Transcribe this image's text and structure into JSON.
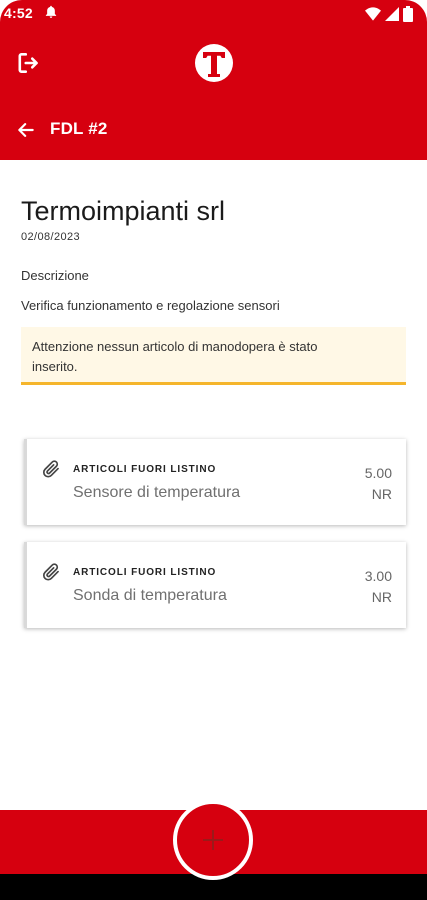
{
  "status_bar": {
    "time": "4:52"
  },
  "toolbar": {
    "title": "FDL #2"
  },
  "work_order": {
    "client_name": "Termoimpianti srl",
    "date": "02/08/2023",
    "description_label": "Descrizione",
    "description": "Verifica funzionamento e regolazione sensori",
    "warning_line1": "Attenzione nessun articolo di manodopera è stato",
    "warning_line2": "inserito."
  },
  "items": [
    {
      "category": "ARTICOLI FUORI LISTINO",
      "name": "Sensore di temperatura",
      "quantity": "5.00",
      "unit": "NR"
    },
    {
      "category": "ARTICOLI FUORI LISTINO",
      "name": "Sonda di temperatura",
      "quantity": "3.00",
      "unit": "NR"
    }
  ],
  "icons": {
    "logout": "logout-icon",
    "back": "arrow-back-icon",
    "attachment": "paperclip-icon",
    "add": "plus-icon"
  },
  "colors": {
    "primary": "#d6000f",
    "warning_bg": "#fff8e6",
    "warning_border": "#f5b52b"
  }
}
